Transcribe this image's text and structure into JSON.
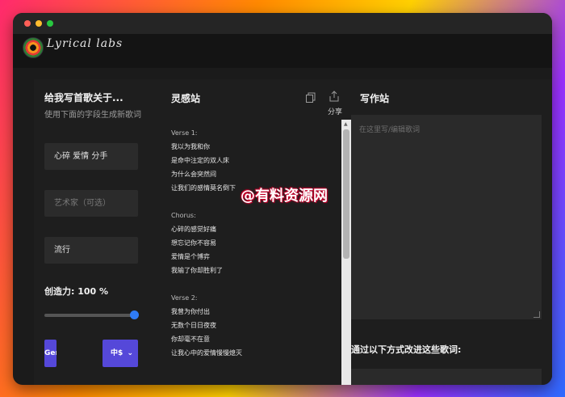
{
  "brand": {
    "name": "Lyrical labs"
  },
  "left": {
    "title": "给我写首歌关于...",
    "subtitle": "使用下面的字段生成新歌词",
    "topic_value": "心碎 爱情 分手",
    "artist_placeholder": "艺术家（可选）",
    "genre_value": "流行",
    "creativity_label": "创造力:",
    "creativity_value": "100 %",
    "creativity_level": 1.0,
    "generate_label": "Gen",
    "language_label": "中$"
  },
  "middle": {
    "title": "灵感站",
    "share_label": "分享",
    "verse1_tag": "Verse 1:",
    "verse1": [
      "我以为我和你",
      "是命中注定的双人床",
      "为什么会突然间",
      "让我们的感情莫名倒下"
    ],
    "chorus_tag": "Chorus:",
    "chorus": [
      "心碎的感觉好痛",
      "想忘记你不容易",
      "爱情是个博弈",
      "我输了你却胜利了"
    ],
    "verse2_tag": "Verse 2:",
    "verse2": [
      "我曾为你付出",
      "无数个日日夜夜",
      "你却毫不在意",
      "让我心中的爱情慢慢熄灭"
    ]
  },
  "right": {
    "title": "写作站",
    "editor_placeholder": "在这里写/编辑歌词",
    "improve_label": "通过以下方式改进这些歌词:"
  },
  "watermark": "@有料资源网",
  "colors": {
    "accent": "#5548d9",
    "slider": "#2f7cf6",
    "panel": "#1e1e1e",
    "field": "#2b2b2b"
  }
}
